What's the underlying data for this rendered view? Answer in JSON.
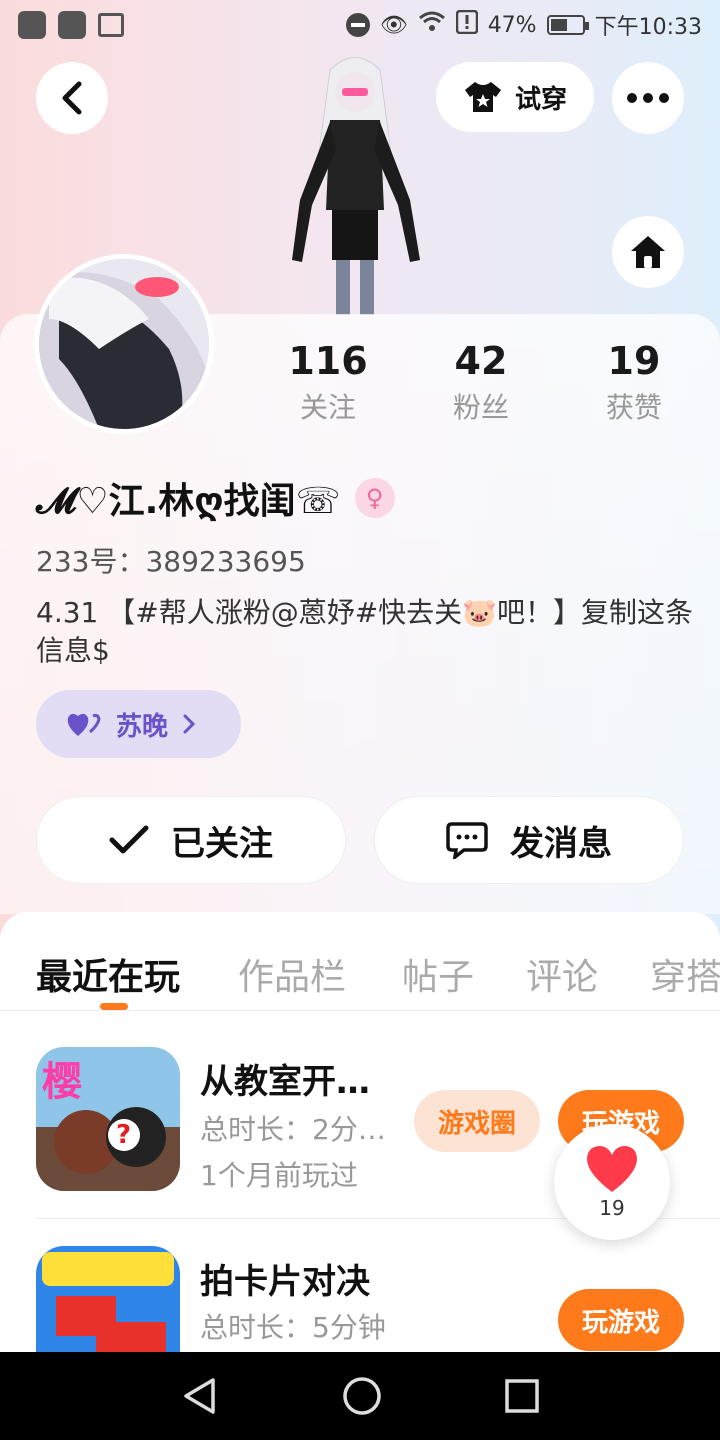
{
  "status_bar": {
    "battery": "47%",
    "time": "下午10:33"
  },
  "header": {
    "try_on_label": "试穿"
  },
  "stats": [
    {
      "value": "116",
      "label": "关注"
    },
    {
      "value": "42",
      "label": "粉丝"
    },
    {
      "value": "19",
      "label": "获赞"
    }
  ],
  "profile": {
    "name": "𝓜♡江.林ღ找闺☏",
    "uid": "233号：389233695",
    "bio": "4.31 【#帮人涨粉@蒽妤#快去关🐷吧！】复制这条信息$",
    "tag_label": "苏晚",
    "gender_symbol": "♀"
  },
  "actions": {
    "followed_label": "已关注",
    "message_label": "发消息"
  },
  "tabs": [
    "最近在玩",
    "作品栏",
    "帖子",
    "评论",
    "穿搭"
  ],
  "games": [
    {
      "title": "从教室开…",
      "duration": "总时长：2分…",
      "last_played": "1个月前玩过",
      "circle_label": "游戏圈",
      "play_label": "玩游戏"
    },
    {
      "title": "拍卡片对决",
      "duration": "总时长：5分钟",
      "play_label": "玩游戏"
    }
  ],
  "like_float": {
    "count": "19"
  },
  "colors": {
    "accent": "#ff7a1a",
    "tag_purple": "#6a52c9"
  }
}
